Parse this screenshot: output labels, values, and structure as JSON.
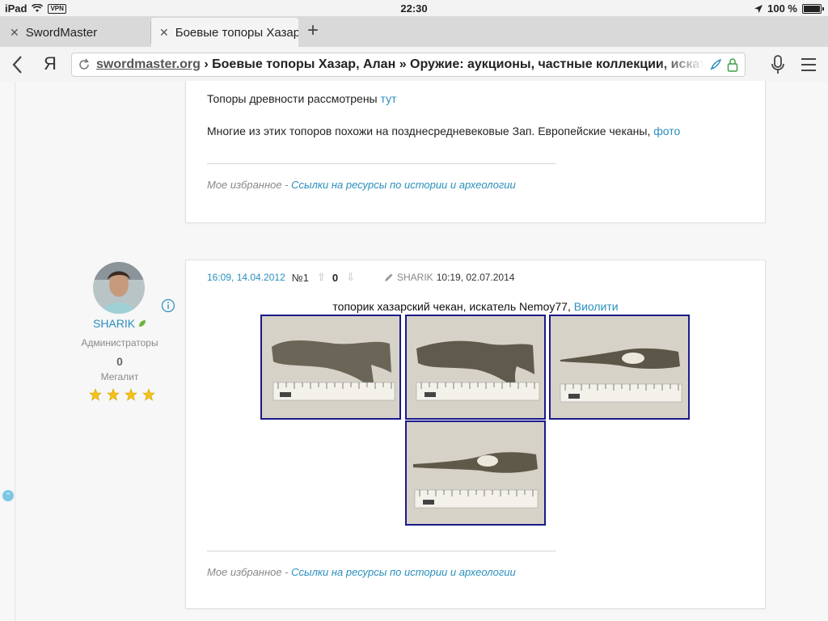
{
  "status_bar": {
    "device": "iPad",
    "vpn": "VPN",
    "time": "22:30",
    "battery": "100 %"
  },
  "tabs": [
    {
      "title": "SwordMaster",
      "close": "✕"
    },
    {
      "title": "Боевые топоры Хазар, Алан",
      "close": "✕"
    }
  ],
  "new_tab": "+",
  "toolbar": {
    "yandex": "Я",
    "address_domain": "swordmaster.org",
    "address_title": " › Боевые топоры Хазар, Алан » Оружие: аукционы, частные коллекции, искатели"
  },
  "post_prev": {
    "line1_text": "Топоры древности рассмотрены ",
    "line1_link": "тут",
    "line2_text": "Многие из этих топоров похожи на позднесредневековые Зап. Европейские чеканы, ",
    "line2_link": "фото",
    "sig_prefix": "Мое избранное - ",
    "sig_link": "Ссылки на ресурсы по истории и археологии"
  },
  "post": {
    "date": "16:09, 14.04.2012",
    "number": "№1",
    "vote_up": "⇧",
    "votes": "0",
    "vote_down": "⇩",
    "edited_by": "SHARIK",
    "edited_at": "10:19, 02.07.2014",
    "caption_text": "топорик хазарский чекан, искатель Nemoy77, ",
    "caption_link": "Виолити",
    "sig_prefix": "Мое избранное - ",
    "sig_link": "Ссылки на ресурсы по истории и археологии"
  },
  "author": {
    "name": "SHARIK",
    "group": "Администраторы",
    "reputation": "0",
    "rank": "Мегалит",
    "stars": 4
  },
  "colors": {
    "link": "#2a8fbd",
    "photo_border": "#1a1a8a",
    "star": "#f2c21b"
  }
}
